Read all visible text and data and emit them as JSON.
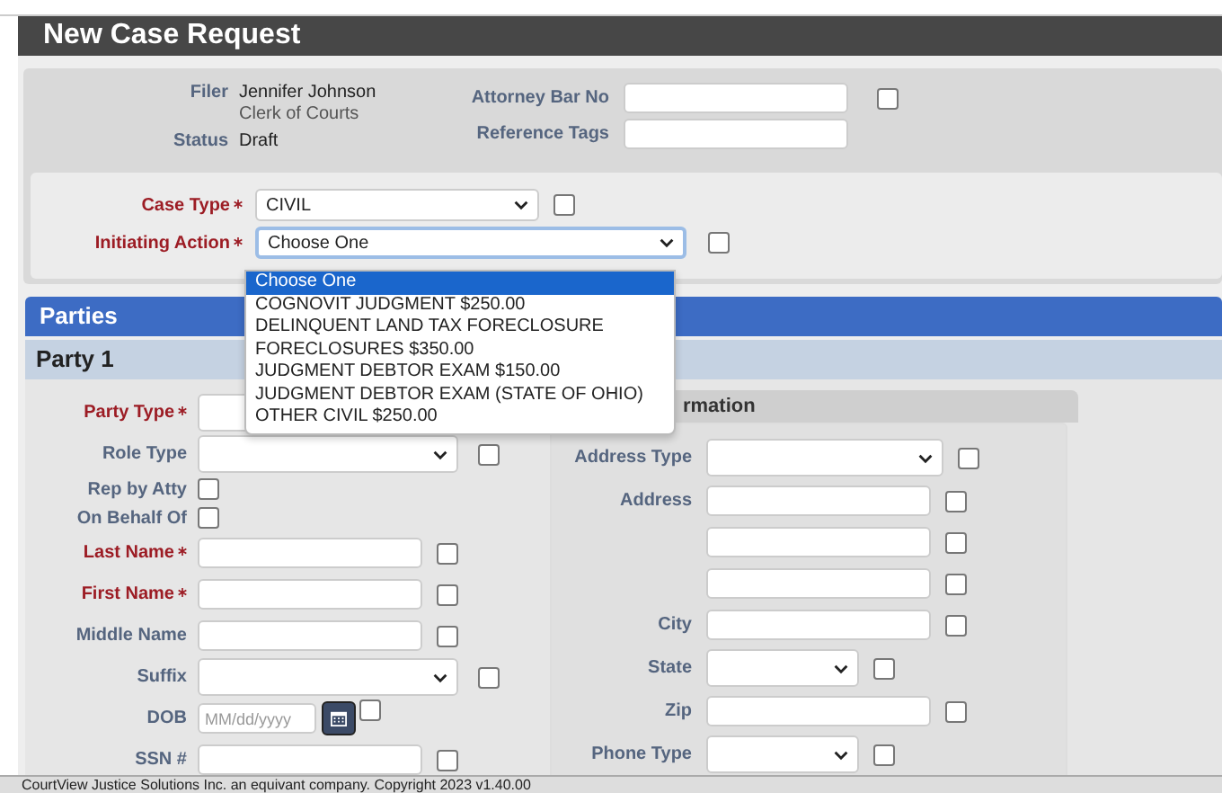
{
  "window": {
    "title": "New Case Request"
  },
  "header": {
    "filer": {
      "label": "Filer",
      "name": "Jennifer Johnson",
      "role": "Clerk of Courts"
    },
    "status": {
      "label": "Status",
      "value": "Draft"
    },
    "attorney_bar_no": {
      "label": "Attorney Bar No",
      "checked": false
    },
    "reference_tags": {
      "label": "Reference Tags"
    }
  },
  "case": {
    "case_type": {
      "label": "Case Type",
      "required": true,
      "value": "CIVIL",
      "checked": false
    },
    "initiating_action": {
      "label": "Initiating Action",
      "required": true,
      "value": "Choose One",
      "checked": false,
      "options": [
        {
          "label": "Choose One",
          "selected": true
        },
        {
          "label": "COGNOVIT JUDGMENT $250.00",
          "selected": false
        },
        {
          "label": "DELINQUENT LAND TAX FORECLOSURE",
          "selected": false
        },
        {
          "label": "FORECLOSURES $350.00",
          "selected": false
        },
        {
          "label": "JUDGMENT DEBTOR EXAM $150.00",
          "selected": false
        },
        {
          "label": "JUDGMENT DEBTOR EXAM (STATE OF OHIO)",
          "selected": false
        },
        {
          "label": "OTHER CIVIL $250.00",
          "selected": false
        }
      ]
    }
  },
  "parties": {
    "title": "Parties",
    "party_title": "Party 1",
    "fields": [
      {
        "kind": "blank",
        "label": "Party Type",
        "required": true
      },
      {
        "kind": "select",
        "label": "Role Type",
        "required": false,
        "checked": false
      },
      {
        "kind": "check",
        "label": "Rep by Atty",
        "required": false,
        "checked": false
      },
      {
        "kind": "check",
        "label": "On Behalf Of",
        "required": false,
        "checked": false
      },
      {
        "kind": "text",
        "label": "Last Name",
        "required": true,
        "checked": false
      },
      {
        "kind": "text",
        "label": "First Name",
        "required": true,
        "checked": false
      },
      {
        "kind": "text",
        "label": "Middle Name",
        "required": false,
        "checked": false
      },
      {
        "kind": "select",
        "label": "Suffix",
        "required": false,
        "checked": false
      },
      {
        "kind": "date",
        "label": "DOB",
        "required": false,
        "placeholder": "MM/dd/yyyy",
        "checked": false
      },
      {
        "kind": "text",
        "label": "SSN #",
        "required": false,
        "checked": false
      }
    ],
    "address": {
      "title": "rmation",
      "fields": [
        {
          "kind": "select",
          "label": "Address Type",
          "checked": false
        },
        {
          "kind": "text",
          "label": "Address",
          "checked": false
        },
        {
          "kind": "text",
          "checked": false
        },
        {
          "kind": "text",
          "checked": false
        },
        {
          "kind": "text",
          "label": "City",
          "checked": false
        },
        {
          "kind": "select",
          "label": "State",
          "checked": false
        },
        {
          "kind": "text",
          "label": "Zip",
          "checked": false
        },
        {
          "kind": "select",
          "label": "Phone Type",
          "checked": false
        }
      ]
    }
  },
  "footer": "CourtView Justice Solutions Inc. an equivant company. Copyright 2023 v1.40.00"
}
